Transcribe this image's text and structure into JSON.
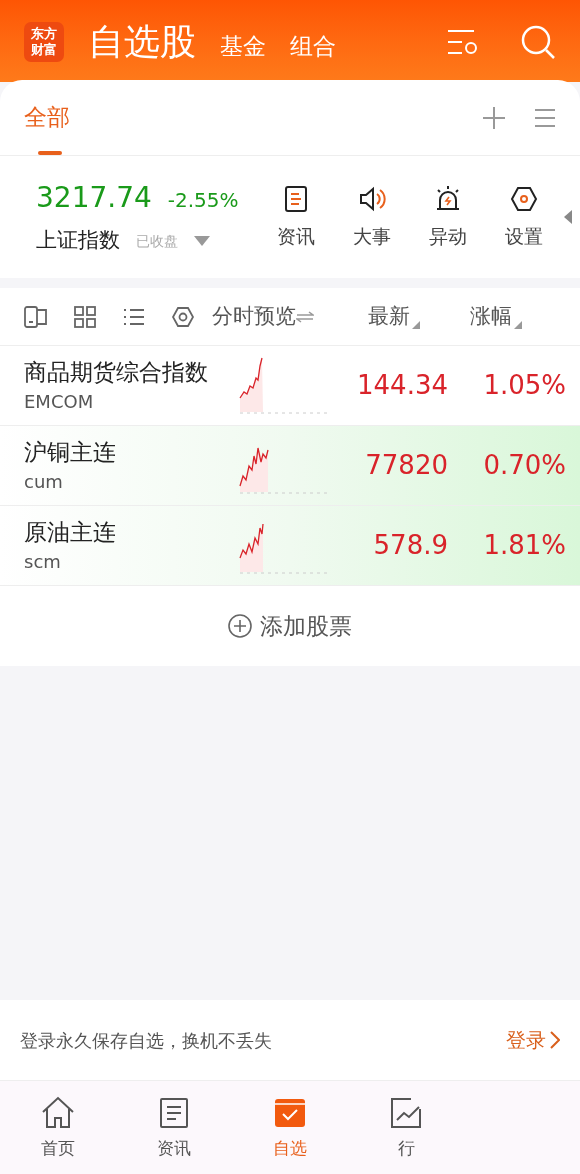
{
  "header": {
    "logo": [
      "东方",
      "财富"
    ],
    "tabs": [
      {
        "label": "自选股",
        "selected": true
      },
      {
        "label": "基金",
        "selected": false
      },
      {
        "label": "组合",
        "selected": false
      }
    ]
  },
  "groups": [
    {
      "label": "全部",
      "selected": true
    }
  ],
  "index": {
    "value": "3217.74",
    "change": "-2.55%",
    "name": "上证指数",
    "status": "已收盘"
  },
  "shortcuts": [
    {
      "kind": "news",
      "label": "资讯"
    },
    {
      "kind": "events",
      "label": "大事"
    },
    {
      "kind": "alert",
      "label": "异动"
    },
    {
      "kind": "settings",
      "label": "设置"
    }
  ],
  "toolbar": {
    "preview": "分时预览",
    "columns": [
      "最新",
      "涨幅"
    ]
  },
  "rows": [
    {
      "name": "商品期货综合指数",
      "code": "EMCOM",
      "price": "144.34",
      "change": "1.05%",
      "highlighted": false
    },
    {
      "name": "沪铜主连",
      "code": "cum",
      "price": "77820",
      "change": "0.70%",
      "highlighted": true
    },
    {
      "name": "原油主连",
      "code": "scm",
      "price": "578.9",
      "change": "1.81%",
      "highlighted": true
    }
  ],
  "add_stock": "添加股票",
  "login_bar": {
    "message": "登录永久保存自选，换机不丢失",
    "action": "登录"
  },
  "bottom_nav": [
    {
      "kind": "home",
      "label": "首页",
      "selected": false
    },
    {
      "kind": "news",
      "label": "资讯",
      "selected": false
    },
    {
      "kind": "watchlist",
      "label": "自选",
      "selected": true
    },
    {
      "kind": "market",
      "label": "行",
      "selected": false
    }
  ]
}
